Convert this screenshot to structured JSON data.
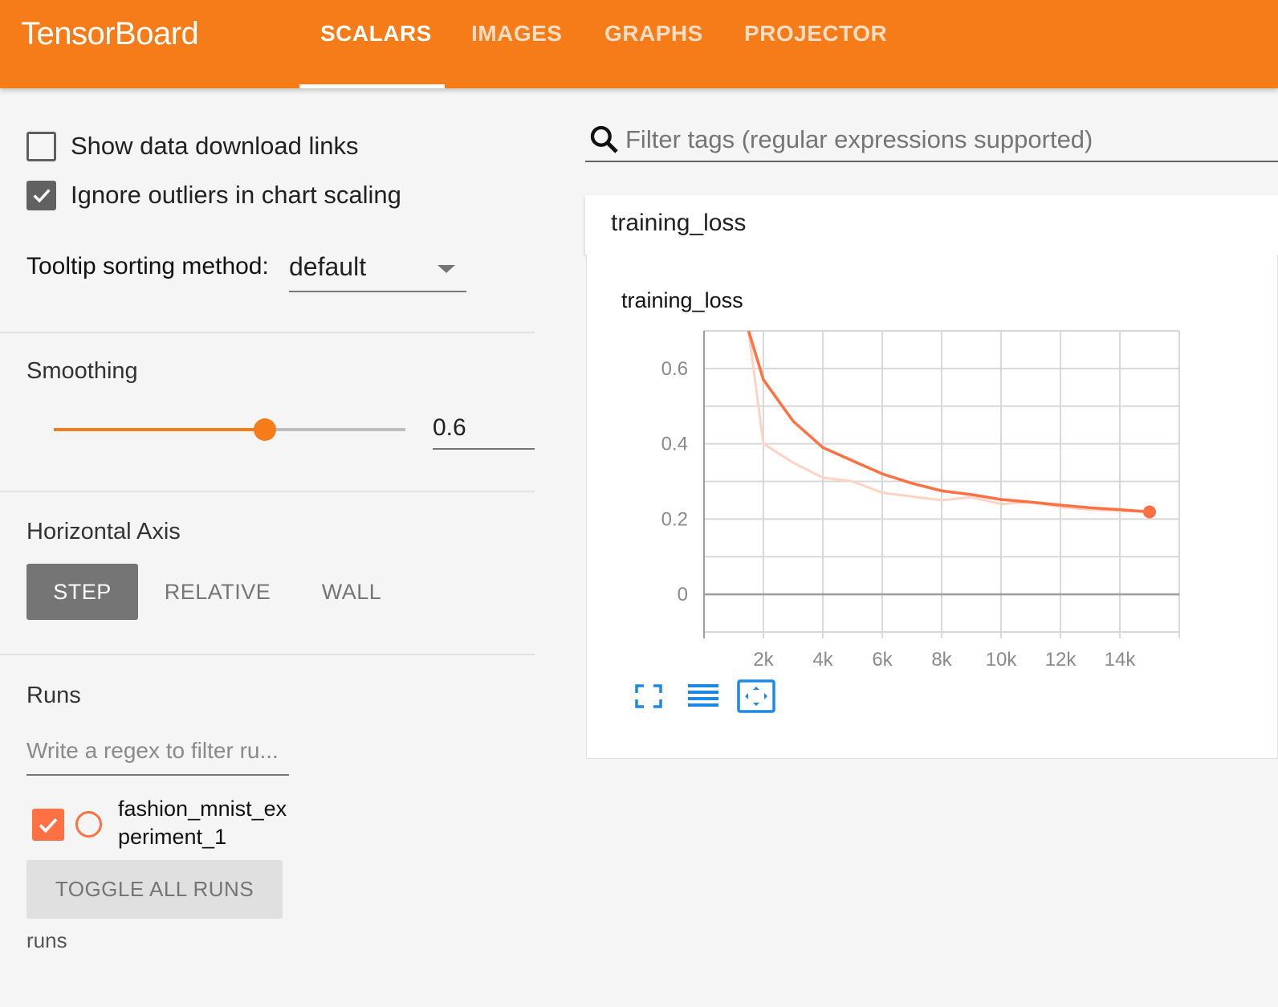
{
  "header": {
    "brand": "TensorBoard",
    "tabs": [
      {
        "label": "SCALARS",
        "active": true
      },
      {
        "label": "IMAGES",
        "active": false
      },
      {
        "label": "GRAPHS",
        "active": false
      },
      {
        "label": "PROJECTOR",
        "active": false
      }
    ]
  },
  "sidebar": {
    "show_download_links": {
      "label": "Show data download links",
      "checked": false
    },
    "ignore_outliers": {
      "label": "Ignore outliers in chart scaling",
      "checked": true
    },
    "tooltip_sorting": {
      "label": "Tooltip sorting method:",
      "value": "default"
    },
    "smoothing": {
      "title": "Smoothing",
      "value": "0.6",
      "fraction": 0.6
    },
    "horizontal_axis": {
      "title": "Horizontal Axis",
      "options": [
        {
          "label": "STEP",
          "active": true
        },
        {
          "label": "RELATIVE",
          "active": false
        },
        {
          "label": "WALL",
          "active": false
        }
      ]
    },
    "runs": {
      "title": "Runs",
      "filter_placeholder": "Write a regex to filter ru...",
      "items": [
        {
          "name": "fashion_mnist_experiment_1",
          "checked": true,
          "color": "#ff7043"
        }
      ],
      "toggle_label": "TOGGLE ALL RUNS",
      "footer": "runs"
    }
  },
  "main": {
    "tag_filter_placeholder": "Filter tags (regular expressions supported)",
    "category": "training_loss",
    "card_title": "training_loss",
    "chart_icons": [
      "fullscreen-icon",
      "data-table-icon",
      "fit-domain-icon"
    ]
  },
  "colors": {
    "accent": "#f57c18",
    "run": "#ff7043",
    "icon_blue": "#1e88e5"
  },
  "chart_data": {
    "type": "line",
    "title": "training_loss",
    "xlabel": "",
    "ylabel": "",
    "xlim": [
      0,
      16000
    ],
    "ylim": [
      -0.1,
      0.7
    ],
    "x_ticks": [
      "2k",
      "4k",
      "6k",
      "8k",
      "10k",
      "12k",
      "14k"
    ],
    "x_tick_values": [
      2000,
      4000,
      6000,
      8000,
      10000,
      12000,
      14000
    ],
    "y_ticks": [
      "0",
      "0.2",
      "0.4",
      "0.6"
    ],
    "y_tick_values": [
      0,
      0.2,
      0.4,
      0.6
    ],
    "grid": true,
    "series": [
      {
        "role": "smoothed",
        "x": [
          1500,
          2000,
          3000,
          4000,
          5000,
          6000,
          7000,
          8000,
          9000,
          10000,
          11000,
          12000,
          13000,
          14000,
          15000
        ],
        "values": [
          0.7,
          0.57,
          0.46,
          0.39,
          0.355,
          0.32,
          0.295,
          0.275,
          0.265,
          0.252,
          0.245,
          0.237,
          0.23,
          0.225,
          0.219
        ]
      },
      {
        "role": "raw",
        "x": [
          1500,
          1750,
          2000,
          3000,
          4000,
          5000,
          6000,
          7000,
          8000,
          9000,
          10000,
          11000,
          12000,
          13000,
          14000,
          15000
        ],
        "values": [
          0.7,
          0.55,
          0.4,
          0.35,
          0.31,
          0.3,
          0.27,
          0.26,
          0.25,
          0.258,
          0.24,
          0.245,
          0.232,
          0.225,
          0.222,
          0.219
        ]
      }
    ]
  }
}
